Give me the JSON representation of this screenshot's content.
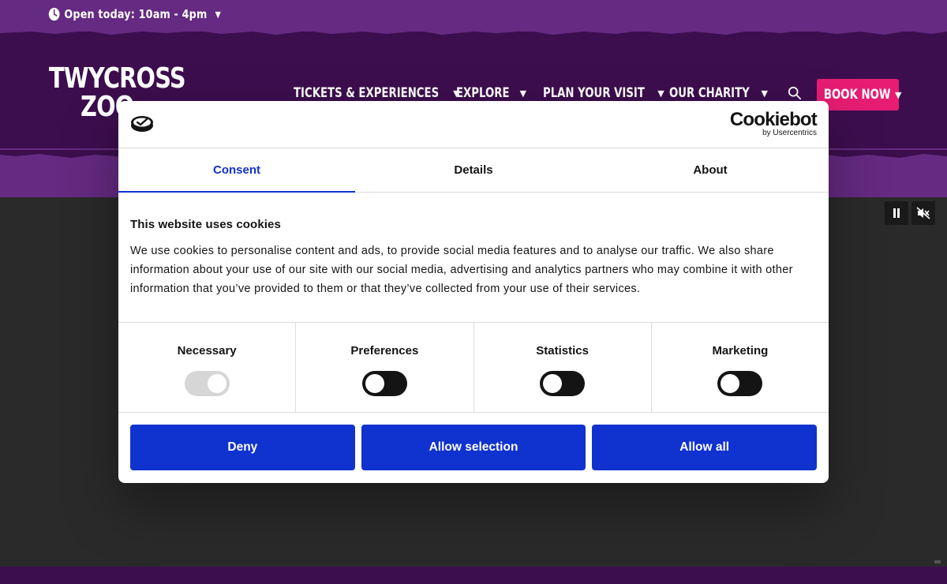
{
  "topbar": {
    "hours_text": "Open today: 10am - 4pm",
    "clock_icon": "clock-icon",
    "caret_icon": "chevron-down-icon"
  },
  "header": {
    "logo_line1": "TWYCROSS",
    "logo_line2": "ZOO",
    "nav": [
      {
        "label": "TICKETS & EXPERIENCES"
      },
      {
        "label": "EXPLORE"
      },
      {
        "label": "PLAN YOUR VISIT"
      },
      {
        "label": "OUR CHARITY"
      }
    ],
    "search_icon": "search-icon",
    "book_now": "BOOK NOW"
  },
  "video_controls": {
    "pause_icon": "pause-icon",
    "mute_icon": "mute-icon"
  },
  "cookie_dialog": {
    "brand": "Cookiebot",
    "brand_sub": "by Usercentrics",
    "tabs": [
      {
        "label": "Consent",
        "active": true
      },
      {
        "label": "Details",
        "active": false
      },
      {
        "label": "About",
        "active": false
      }
    ],
    "title": "This website uses cookies",
    "description": "We use cookies to personalise content and ads, to provide social media features and to analyse our traffic. We also share information about your use of our site with our social media, advertising and analytics partners who may combine it with other information that you’ve provided to them or that they’ve collected from your use of their services.",
    "categories": [
      {
        "label": "Necessary",
        "enabled": true,
        "locked": true
      },
      {
        "label": "Preferences",
        "enabled": false,
        "locked": false
      },
      {
        "label": "Statistics",
        "enabled": false,
        "locked": false
      },
      {
        "label": "Marketing",
        "enabled": false,
        "locked": false
      }
    ],
    "buttons": {
      "deny": "Deny",
      "allow_selection": "Allow selection",
      "allow_all": "Allow all"
    }
  },
  "colors": {
    "purple_light": "#652a82",
    "purple_dark": "#3d0e4e",
    "pink": "#e71d73",
    "cookiebot_blue": "#1032cf"
  }
}
